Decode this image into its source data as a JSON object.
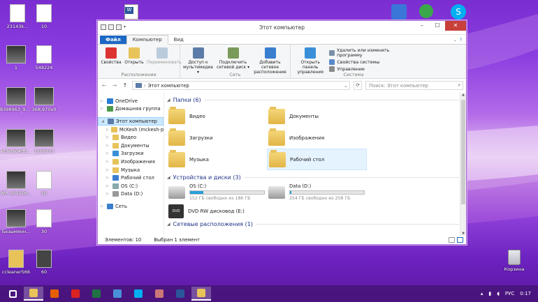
{
  "desktop": {
    "icons": [
      {
        "label": "23143k...",
        "icon": "video-file-icon"
      },
      {
        "label": "10",
        "icon": "document-icon"
      },
      {
        "label": "1",
        "icon": "image-file-icon"
      },
      {
        "label": "548224",
        "icon": "document-icon"
      },
      {
        "label": "8398963_97...",
        "icon": "image-file-icon"
      },
      {
        "label": "368,970x0",
        "icon": "image-file-icon"
      },
      {
        "label": "ef3ef804ffb...",
        "icon": "image-file-icon"
      },
      {
        "label": "3109373",
        "icon": "image-file-icon"
      },
      {
        "label": "WP_201506...",
        "icon": "image-file-icon"
      },
      {
        "label": "20",
        "icon": "document-icon"
      },
      {
        "label": "Безымянн...",
        "icon": "image-file-icon"
      },
      {
        "label": "30",
        "icon": "document-icon"
      },
      {
        "label": "ccleaner566",
        "icon": "installer-icon"
      },
      {
        "label": "60",
        "icon": "dvd-icon"
      }
    ],
    "top_icons": [
      "word-document-icon",
      "network-icon",
      "green-globe-icon",
      "skype-icon"
    ],
    "recycle_bin": "Корзина"
  },
  "window": {
    "title": "Этот компьютер",
    "tabs": {
      "file": "Файл",
      "computer": "Компьютер",
      "view": "Вид"
    },
    "ribbon": {
      "location": {
        "label": "Расположение",
        "buttons": [
          "Свойства",
          "Открыть",
          "Переименовать"
        ]
      },
      "network": {
        "label": "Сеть",
        "buttons": [
          "Доступ к мультимедиа ▾",
          "Подключить сетевой диск ▾",
          "Добавить сетевое расположение"
        ]
      },
      "system": {
        "label": "Система",
        "open_panel": "Открыть панель управления",
        "small": [
          "Удалить или изменить программу",
          "Свойства системы",
          "Управление"
        ]
      }
    },
    "address": {
      "path": "Этот компьютер",
      "search_placeholder": "Поиск: Этот компьютер"
    },
    "nav_tree": [
      {
        "label": "OneDrive",
        "icon": "onedrive-icon",
        "indent": 0
      },
      {
        "label": "Домашняя группа",
        "icon": "homegroup-icon",
        "indent": 0
      },
      {
        "label": "Этот компьютер",
        "icon": "computer-icon",
        "indent": 0,
        "selected": true
      },
      {
        "label": "McKesh (mckesh-pc)",
        "icon": "user-folder-icon",
        "indent": 1
      },
      {
        "label": "Видео",
        "icon": "video-folder-icon",
        "indent": 1
      },
      {
        "label": "Документы",
        "icon": "documents-folder-icon",
        "indent": 1
      },
      {
        "label": "Загрузки",
        "icon": "downloads-folder-icon",
        "indent": 1
      },
      {
        "label": "Изображения",
        "icon": "pictures-folder-icon",
        "indent": 1
      },
      {
        "label": "Музыка",
        "icon": "music-folder-icon",
        "indent": 1
      },
      {
        "label": "Рабочий стол",
        "icon": "desktop-folder-icon",
        "indent": 1
      },
      {
        "label": "OS (C:)",
        "icon": "os-drive-icon",
        "indent": 1
      },
      {
        "label": "Data (D:)",
        "icon": "drive-icon",
        "indent": 1
      },
      {
        "label": "Сеть",
        "icon": "network-icon",
        "indent": 0
      }
    ],
    "folders_header": "Папки (6)",
    "folders": [
      "Видео",
      "Документы",
      "Загрузки",
      "Изображения",
      "Музыка",
      "Рабочий стол"
    ],
    "drives_header": "Устройства и диски (3)",
    "drives": [
      {
        "name": "OS (C:)",
        "free": "152 ГБ свободно из 186 ГБ",
        "used_fraction": 0.18
      },
      {
        "name": "Data (D:)",
        "free": "254 ГБ свободно из 258 ГБ",
        "used_fraction": 0.02
      }
    ],
    "dvd": "DVD RW дисковод (E:)",
    "network_header": "Сетевые расположения (1)",
    "status": {
      "items": "Элементов: 10",
      "selected": "Выбран 1 элемент"
    }
  },
  "taskbar": {
    "apps": [
      "windows-start-icon",
      "explorer-icon",
      "firefox-icon",
      "yandex-icon",
      "excel-icon",
      "chrome-icon",
      "skype-icon",
      "paint-icon",
      "word-icon",
      "explorer-2-icon"
    ],
    "lang": "РУС",
    "time": "0:17"
  }
}
